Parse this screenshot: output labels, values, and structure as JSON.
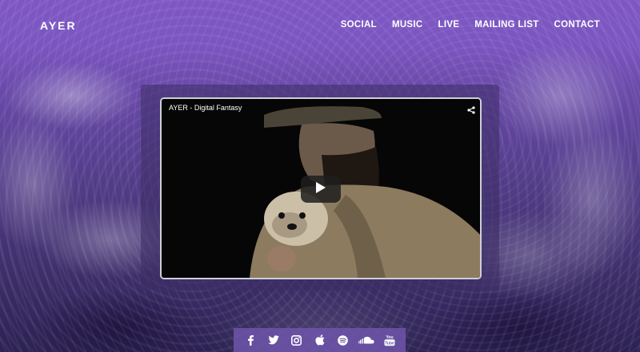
{
  "brand": {
    "logo": "AYER"
  },
  "nav": {
    "items": [
      {
        "label": "SOCIAL"
      },
      {
        "label": "MUSIC"
      },
      {
        "label": "LIVE"
      },
      {
        "label": "MAILING LIST"
      },
      {
        "label": "CONTACT"
      }
    ]
  },
  "video": {
    "title": "AYER - Digital Fantasy",
    "share_icon": "share-icon",
    "play_icon": "play-icon"
  },
  "social": {
    "icons": [
      "facebook-icon",
      "twitter-icon",
      "instagram-icon",
      "apple-icon",
      "spotify-icon",
      "soundcloud-icon",
      "youtube-icon"
    ],
    "youtube_label": "You Tube"
  },
  "colors": {
    "accent": "#7e57c4",
    "background_dark": "#2c2252",
    "text": "#ffffff"
  }
}
